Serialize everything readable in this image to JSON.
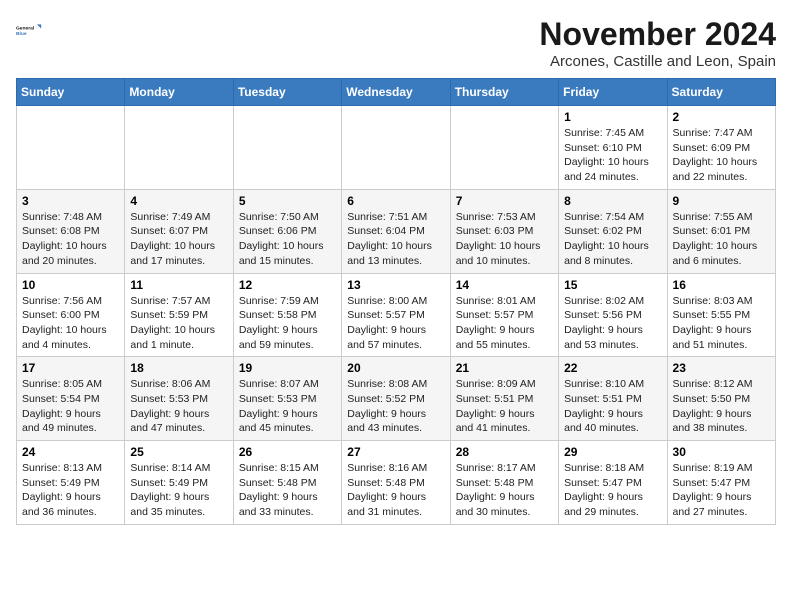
{
  "logo": {
    "line1": "General",
    "line2": "Blue"
  },
  "title": "November 2024",
  "location": "Arcones, Castille and Leon, Spain",
  "weekdays": [
    "Sunday",
    "Monday",
    "Tuesday",
    "Wednesday",
    "Thursday",
    "Friday",
    "Saturday"
  ],
  "weeks": [
    [
      {
        "day": "",
        "info": ""
      },
      {
        "day": "",
        "info": ""
      },
      {
        "day": "",
        "info": ""
      },
      {
        "day": "",
        "info": ""
      },
      {
        "day": "",
        "info": ""
      },
      {
        "day": "1",
        "info": "Sunrise: 7:45 AM\nSunset: 6:10 PM\nDaylight: 10 hours and 24 minutes."
      },
      {
        "day": "2",
        "info": "Sunrise: 7:47 AM\nSunset: 6:09 PM\nDaylight: 10 hours and 22 minutes."
      }
    ],
    [
      {
        "day": "3",
        "info": "Sunrise: 7:48 AM\nSunset: 6:08 PM\nDaylight: 10 hours and 20 minutes."
      },
      {
        "day": "4",
        "info": "Sunrise: 7:49 AM\nSunset: 6:07 PM\nDaylight: 10 hours and 17 minutes."
      },
      {
        "day": "5",
        "info": "Sunrise: 7:50 AM\nSunset: 6:06 PM\nDaylight: 10 hours and 15 minutes."
      },
      {
        "day": "6",
        "info": "Sunrise: 7:51 AM\nSunset: 6:04 PM\nDaylight: 10 hours and 13 minutes."
      },
      {
        "day": "7",
        "info": "Sunrise: 7:53 AM\nSunset: 6:03 PM\nDaylight: 10 hours and 10 minutes."
      },
      {
        "day": "8",
        "info": "Sunrise: 7:54 AM\nSunset: 6:02 PM\nDaylight: 10 hours and 8 minutes."
      },
      {
        "day": "9",
        "info": "Sunrise: 7:55 AM\nSunset: 6:01 PM\nDaylight: 10 hours and 6 minutes."
      }
    ],
    [
      {
        "day": "10",
        "info": "Sunrise: 7:56 AM\nSunset: 6:00 PM\nDaylight: 10 hours and 4 minutes."
      },
      {
        "day": "11",
        "info": "Sunrise: 7:57 AM\nSunset: 5:59 PM\nDaylight: 10 hours and 1 minute."
      },
      {
        "day": "12",
        "info": "Sunrise: 7:59 AM\nSunset: 5:58 PM\nDaylight: 9 hours and 59 minutes."
      },
      {
        "day": "13",
        "info": "Sunrise: 8:00 AM\nSunset: 5:57 PM\nDaylight: 9 hours and 57 minutes."
      },
      {
        "day": "14",
        "info": "Sunrise: 8:01 AM\nSunset: 5:57 PM\nDaylight: 9 hours and 55 minutes."
      },
      {
        "day": "15",
        "info": "Sunrise: 8:02 AM\nSunset: 5:56 PM\nDaylight: 9 hours and 53 minutes."
      },
      {
        "day": "16",
        "info": "Sunrise: 8:03 AM\nSunset: 5:55 PM\nDaylight: 9 hours and 51 minutes."
      }
    ],
    [
      {
        "day": "17",
        "info": "Sunrise: 8:05 AM\nSunset: 5:54 PM\nDaylight: 9 hours and 49 minutes."
      },
      {
        "day": "18",
        "info": "Sunrise: 8:06 AM\nSunset: 5:53 PM\nDaylight: 9 hours and 47 minutes."
      },
      {
        "day": "19",
        "info": "Sunrise: 8:07 AM\nSunset: 5:53 PM\nDaylight: 9 hours and 45 minutes."
      },
      {
        "day": "20",
        "info": "Sunrise: 8:08 AM\nSunset: 5:52 PM\nDaylight: 9 hours and 43 minutes."
      },
      {
        "day": "21",
        "info": "Sunrise: 8:09 AM\nSunset: 5:51 PM\nDaylight: 9 hours and 41 minutes."
      },
      {
        "day": "22",
        "info": "Sunrise: 8:10 AM\nSunset: 5:51 PM\nDaylight: 9 hours and 40 minutes."
      },
      {
        "day": "23",
        "info": "Sunrise: 8:12 AM\nSunset: 5:50 PM\nDaylight: 9 hours and 38 minutes."
      }
    ],
    [
      {
        "day": "24",
        "info": "Sunrise: 8:13 AM\nSunset: 5:49 PM\nDaylight: 9 hours and 36 minutes."
      },
      {
        "day": "25",
        "info": "Sunrise: 8:14 AM\nSunset: 5:49 PM\nDaylight: 9 hours and 35 minutes."
      },
      {
        "day": "26",
        "info": "Sunrise: 8:15 AM\nSunset: 5:48 PM\nDaylight: 9 hours and 33 minutes."
      },
      {
        "day": "27",
        "info": "Sunrise: 8:16 AM\nSunset: 5:48 PM\nDaylight: 9 hours and 31 minutes."
      },
      {
        "day": "28",
        "info": "Sunrise: 8:17 AM\nSunset: 5:48 PM\nDaylight: 9 hours and 30 minutes."
      },
      {
        "day": "29",
        "info": "Sunrise: 8:18 AM\nSunset: 5:47 PM\nDaylight: 9 hours and 29 minutes."
      },
      {
        "day": "30",
        "info": "Sunrise: 8:19 AM\nSunset: 5:47 PM\nDaylight: 9 hours and 27 minutes."
      }
    ]
  ]
}
